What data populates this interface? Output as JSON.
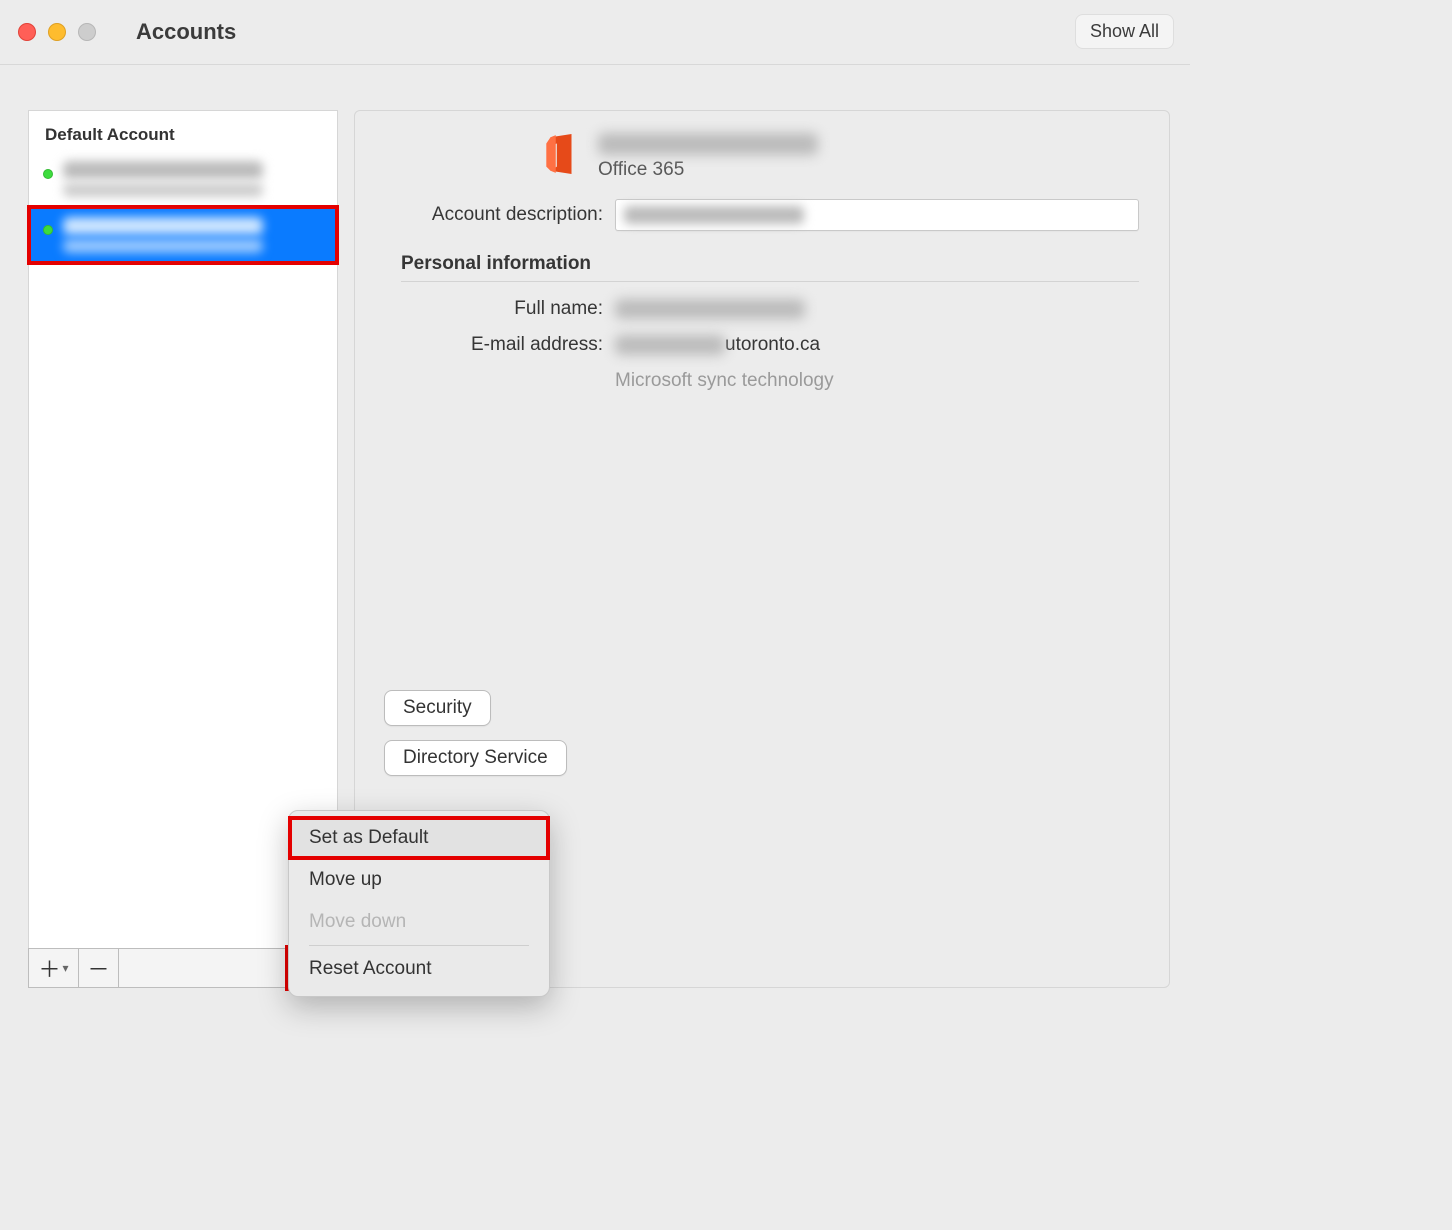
{
  "window": {
    "title": "Accounts",
    "show_all": "Show All"
  },
  "sidebar": {
    "heading": "Default Account",
    "items": [
      {
        "name": "[redacted]",
        "subtitle": "[redacted]",
        "selected": false
      },
      {
        "name": "[redacted]",
        "subtitle": "[redacted]",
        "selected": true
      }
    ]
  },
  "toolbar": {
    "add_symbol": "＋",
    "remove_symbol": "－"
  },
  "detail": {
    "account_type": "Office 365",
    "labels": {
      "account_description": "Account description:",
      "personal_info": "Personal information",
      "full_name": "Full name:",
      "email": "E-mail address:",
      "sync": "Microsoft sync technology"
    },
    "values": {
      "account_description": "[redacted]",
      "full_name": "[redacted]",
      "email_suffix": "utoronto.ca"
    },
    "buttons": {
      "security": "Security",
      "directory": "Directory Service"
    }
  },
  "popup": {
    "set_default": "Set as Default",
    "move_up": "Move up",
    "move_down": "Move down",
    "reset": "Reset Account"
  }
}
